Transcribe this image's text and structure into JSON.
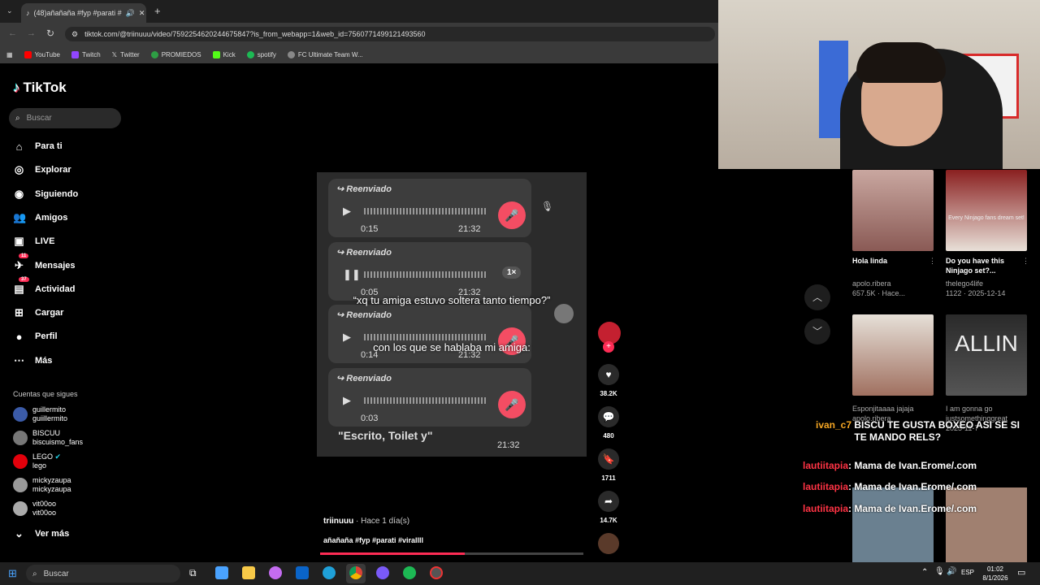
{
  "browser": {
    "tab_title": "(48)añañaña #fyp #parati #",
    "url": "tiktok.com/@triinuuu/video/7592254620244675847?is_from_webapp=1&web_id=7560771499121493560",
    "bookmarks": [
      "YouTube",
      "Twitch",
      "Twitter",
      "PROMIEDOS",
      "Kick",
      "spotify",
      "FC Ultimate Team W..."
    ],
    "colors": {
      "youtube": "#ff0000",
      "twitch": "#9146ff",
      "kick": "#53fc18",
      "spotify": "#1db954"
    }
  },
  "tiktok": {
    "logo_text": "TikTok",
    "search_placeholder": "Buscar",
    "nav": [
      {
        "label": "Para ti",
        "icon": "home-icon"
      },
      {
        "label": "Explorar",
        "icon": "compass-icon"
      },
      {
        "label": "Siguiendo",
        "icon": "following-icon"
      },
      {
        "label": "Amigos",
        "icon": "friends-icon"
      },
      {
        "label": "LIVE",
        "icon": "live-icon"
      },
      {
        "label": "Mensajes",
        "icon": "messages-icon",
        "badge": "11"
      },
      {
        "label": "Actividad",
        "icon": "activity-icon",
        "badge": "37"
      },
      {
        "label": "Cargar",
        "icon": "upload-icon"
      },
      {
        "label": "Perfil",
        "icon": "profile-icon"
      },
      {
        "label": "Más",
        "icon": "more-icon"
      }
    ],
    "following_title": "Cuentas que sigues",
    "following": [
      {
        "name": "guillermito",
        "handle": "guiillermito"
      },
      {
        "name": "BISCUU",
        "handle": "biscuismo_fans"
      },
      {
        "name": "LEGO",
        "handle": "lego",
        "verified": true
      },
      {
        "name": "mickyzaupa",
        "handle": "mickyzaupa"
      },
      {
        "name": "vit00oo",
        "handle": "vit00oo"
      }
    ],
    "see_more": "Ver más",
    "accent": "#fe2c55"
  },
  "video": {
    "messages": [
      {
        "label": "Reenviado",
        "duration": "0:15",
        "time": "21:32"
      },
      {
        "label": "Reenviado",
        "duration": "0:05",
        "time": "21:32",
        "speed": "1×"
      },
      {
        "label": "Reenviado",
        "duration": "0:14",
        "time": "21:32"
      },
      {
        "label": "Reenviado",
        "duration": "0:03",
        "time": "21:32"
      }
    ],
    "caption1": "“xq tu amiga estuvo soltera tanto tiempo?”",
    "caption2": "con los que se hablaba mi amiga:",
    "quote": "\"Escrito, Toilet y\"",
    "author": "triinuuu",
    "posted": "· Hace 1 día(s)",
    "description": "añañaña #fyp #parati #virallll",
    "progress": 0.55,
    "likes": "38.2K",
    "comments": "480",
    "saves": "1711",
    "shares": "14.7K"
  },
  "recommendations": [
    {
      "title": "Hola linda",
      "author": "apolo.ribera",
      "stats": "657.5K · Hace..."
    },
    {
      "title": "Do you have this Ninjago set?...",
      "author": "thelego4life",
      "stats": "1122 · 2025-12-14",
      "overlay": "Every Ninjago fans dream set!"
    },
    {
      "title": "Esponjitaaaa jajaja",
      "author": "apolo.ribera",
      "stats": ""
    },
    {
      "title": "I am gonna go",
      "author": "justsomethinggreat",
      "stats": "2025-11-7",
      "overlay": "ALLIN"
    }
  ],
  "chat": [
    {
      "user": "ivan_c7",
      "msg": "BISCU TE GUSTA BOXEO ASI SE SI TE MANDO RELS?",
      "color": "#f5a623"
    },
    {
      "user": "lautiitapia",
      "msg": "Mama de Ivan.Erome/.com",
      "color": "#ff3344"
    },
    {
      "user": "lautiitapia",
      "msg": "Mama de Ivan.Erome/.com",
      "color": "#ff3344"
    },
    {
      "user": "lautiitapia",
      "msg": "Mama de Ivan.Erome/.com",
      "color": "#ff3344"
    }
  ],
  "taskbar": {
    "search": "Buscar",
    "lang": "ESP",
    "time": "01:02",
    "date": "8/1/2026"
  }
}
